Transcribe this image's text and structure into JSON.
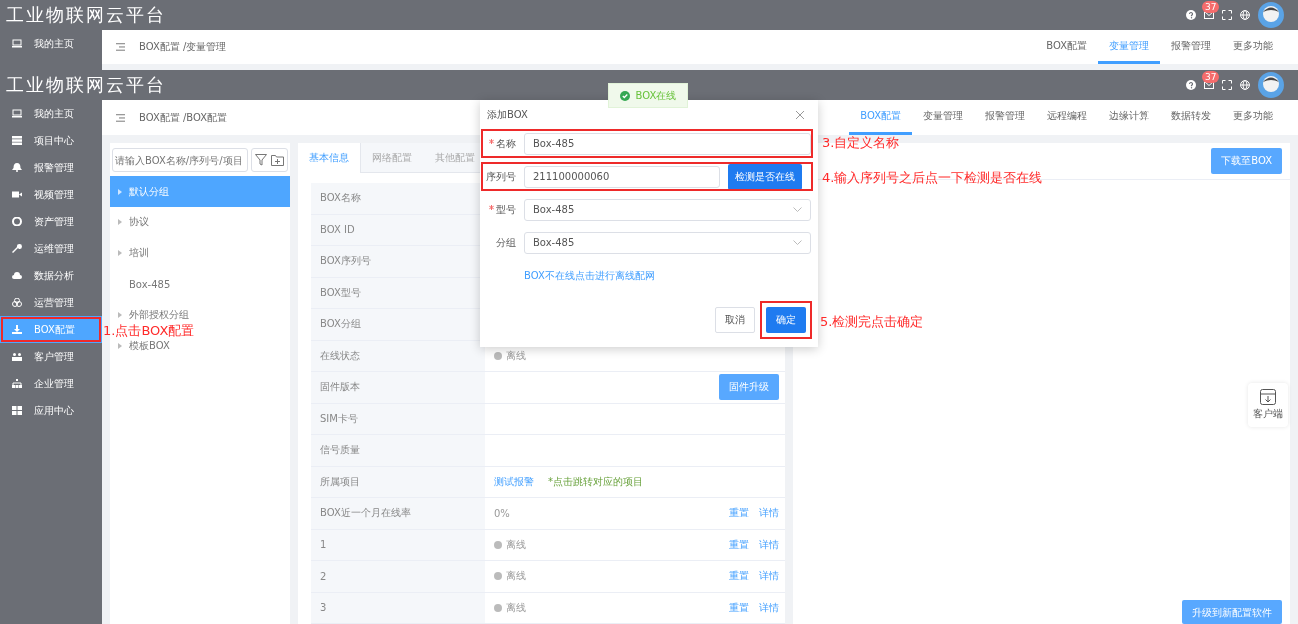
{
  "background_screen": {
    "header": {
      "title": "工业物联网云平台",
      "badge": "37"
    },
    "sidebar": {
      "items": [
        {
          "label": "我的主页",
          "selected": false
        }
      ]
    },
    "breadcrumb": "BOX配置 /变量管理",
    "tabs": [
      {
        "label": "BOX配置",
        "selected": false
      },
      {
        "label": "变量管理",
        "selected": true
      },
      {
        "label": "报警管理",
        "selected": false
      },
      {
        "label": "更多功能",
        "selected": false
      }
    ]
  },
  "header": {
    "title": "工业物联网云平台",
    "badge": "37"
  },
  "sidebar": {
    "items": [
      {
        "label": "我的主页",
        "selected": false,
        "highlighted": false
      },
      {
        "label": "项目中心",
        "selected": false,
        "highlighted": false
      },
      {
        "label": "报警管理",
        "selected": false,
        "highlighted": false
      },
      {
        "label": "视频管理",
        "selected": false,
        "highlighted": false
      },
      {
        "label": "资产管理",
        "selected": false,
        "highlighted": false
      },
      {
        "label": "运维管理",
        "selected": false,
        "highlighted": false
      },
      {
        "label": "数据分析",
        "selected": false,
        "highlighted": false
      },
      {
        "label": "运营管理",
        "selected": false,
        "highlighted": false
      },
      {
        "label": "BOX配置",
        "selected": true,
        "highlighted": true
      },
      {
        "label": "客户管理",
        "selected": false,
        "highlighted": false
      },
      {
        "label": "企业管理",
        "selected": false,
        "highlighted": false
      },
      {
        "label": "应用中心",
        "selected": false,
        "highlighted": false
      }
    ]
  },
  "breadcrumb": "BOX配置 /BOX配置",
  "tabs": [
    {
      "label": "BOX配置",
      "selected": true
    },
    {
      "label": "变量管理",
      "selected": false
    },
    {
      "label": "报警管理",
      "selected": false
    },
    {
      "label": "远程编程",
      "selected": false
    },
    {
      "label": "边缘计算",
      "selected": false
    },
    {
      "label": "数据转发",
      "selected": false
    },
    {
      "label": "更多功能",
      "selected": false
    }
  ],
  "group_panel": {
    "search": {
      "placeholder": "请输入BOX名称/序列号/项目"
    },
    "tree": [
      {
        "label": "默认分组",
        "selected": true,
        "expandable": true
      },
      {
        "label": "协议",
        "selected": false,
        "expandable": true
      },
      {
        "label": "培训",
        "selected": false,
        "expandable": true
      },
      {
        "label": "Box-485",
        "selected": false,
        "expandable": false
      },
      {
        "label": "外部授权分组",
        "selected": false,
        "expandable": true
      },
      {
        "label": "模板BOX",
        "selected": false,
        "expandable": true
      }
    ]
  },
  "detail_card": {
    "tabs": [
      {
        "label": "基本信息",
        "selected": true
      },
      {
        "label": "网络配置",
        "selected": false
      },
      {
        "label": "其他配置",
        "selected": false
      }
    ],
    "rows": [
      {
        "kind": "plain",
        "label": "BOX名称"
      },
      {
        "kind": "plain",
        "label": "BOX ID"
      },
      {
        "kind": "plain",
        "label": "BOX序列号"
      },
      {
        "kind": "plain",
        "label": "BOX型号"
      },
      {
        "kind": "plain",
        "label": "BOX分组"
      },
      {
        "kind": "status",
        "label": "在线状态",
        "status": "离线"
      },
      {
        "kind": "button",
        "label": "固件版本",
        "button": "固件升级"
      },
      {
        "kind": "plain",
        "label": "SIM卡号"
      },
      {
        "kind": "plain",
        "label": "信号质量"
      },
      {
        "kind": "link_note",
        "label": "所属项目",
        "link": "测试报警",
        "note": "*点击跳转对应的项目"
      },
      {
        "kind": "value_actions",
        "label": "BOX近一个月在线率",
        "value": "0%",
        "actions": [
          "重置",
          "详情"
        ]
      },
      {
        "kind": "status_actions",
        "label": "1",
        "status": "离线",
        "actions": [
          "重置",
          "详情"
        ]
      },
      {
        "kind": "status_actions",
        "label": "2",
        "status": "离线",
        "actions": [
          "重置",
          "详情"
        ]
      },
      {
        "kind": "status_actions",
        "label": "3",
        "status": "离线",
        "actions": [
          "重置",
          "详情"
        ]
      }
    ]
  },
  "right_panel": {
    "download_button": "下载至BOX",
    "upgrade_button": "升级到新配置软件"
  },
  "client_widget": {
    "label": "客户端"
  },
  "toast": {
    "text": "BOX在线"
  },
  "dialog": {
    "title": "添加BOX",
    "fields": [
      {
        "kind": "input",
        "label": "名称",
        "required": true,
        "highlighted": true,
        "value": "Box-485"
      },
      {
        "kind": "input_button",
        "label": "序列号",
        "required": false,
        "highlighted": true,
        "value": "211100000060",
        "button": "检测是否在线"
      },
      {
        "kind": "select",
        "label": "型号",
        "required": true,
        "highlighted": false,
        "value": "Box-485"
      },
      {
        "kind": "select",
        "label": "分组",
        "required": false,
        "highlighted": false,
        "value": "Box-485"
      }
    ],
    "link": "BOX不在线点击进行离线配网",
    "cancel": "取消",
    "confirm": "确定",
    "confirm_highlighted": true
  },
  "annotations": [
    {
      "text": "1.点击BOX配置"
    },
    {
      "text": "3.自定义名称"
    },
    {
      "text": "4.输入序列号之后点一下检测是否在线"
    },
    {
      "text": "5.检测完点击确定"
    }
  ]
}
